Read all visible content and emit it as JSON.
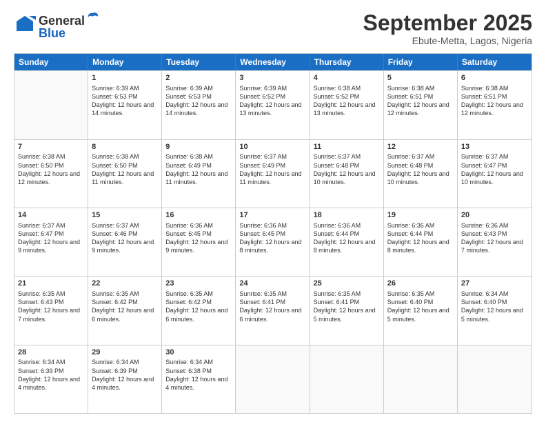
{
  "header": {
    "logo_general": "General",
    "logo_blue": "Blue",
    "month_title": "September 2025",
    "location": "Ebute-Metta, Lagos, Nigeria"
  },
  "calendar": {
    "days_of_week": [
      "Sunday",
      "Monday",
      "Tuesday",
      "Wednesday",
      "Thursday",
      "Friday",
      "Saturday"
    ],
    "weeks": [
      [
        {
          "day": "",
          "sunrise": "",
          "sunset": "",
          "daylight": "",
          "empty": true
        },
        {
          "day": "1",
          "sunrise": "Sunrise: 6:39 AM",
          "sunset": "Sunset: 6:53 PM",
          "daylight": "Daylight: 12 hours and 14 minutes.",
          "empty": false
        },
        {
          "day": "2",
          "sunrise": "Sunrise: 6:39 AM",
          "sunset": "Sunset: 6:53 PM",
          "daylight": "Daylight: 12 hours and 14 minutes.",
          "empty": false
        },
        {
          "day": "3",
          "sunrise": "Sunrise: 6:39 AM",
          "sunset": "Sunset: 6:52 PM",
          "daylight": "Daylight: 12 hours and 13 minutes.",
          "empty": false
        },
        {
          "day": "4",
          "sunrise": "Sunrise: 6:38 AM",
          "sunset": "Sunset: 6:52 PM",
          "daylight": "Daylight: 12 hours and 13 minutes.",
          "empty": false
        },
        {
          "day": "5",
          "sunrise": "Sunrise: 6:38 AM",
          "sunset": "Sunset: 6:51 PM",
          "daylight": "Daylight: 12 hours and 12 minutes.",
          "empty": false
        },
        {
          "day": "6",
          "sunrise": "Sunrise: 6:38 AM",
          "sunset": "Sunset: 6:51 PM",
          "daylight": "Daylight: 12 hours and 12 minutes.",
          "empty": false
        }
      ],
      [
        {
          "day": "7",
          "sunrise": "Sunrise: 6:38 AM",
          "sunset": "Sunset: 6:50 PM",
          "daylight": "Daylight: 12 hours and 12 minutes.",
          "empty": false
        },
        {
          "day": "8",
          "sunrise": "Sunrise: 6:38 AM",
          "sunset": "Sunset: 6:50 PM",
          "daylight": "Daylight: 12 hours and 11 minutes.",
          "empty": false
        },
        {
          "day": "9",
          "sunrise": "Sunrise: 6:38 AM",
          "sunset": "Sunset: 6:49 PM",
          "daylight": "Daylight: 12 hours and 11 minutes.",
          "empty": false
        },
        {
          "day": "10",
          "sunrise": "Sunrise: 6:37 AM",
          "sunset": "Sunset: 6:49 PM",
          "daylight": "Daylight: 12 hours and 11 minutes.",
          "empty": false
        },
        {
          "day": "11",
          "sunrise": "Sunrise: 6:37 AM",
          "sunset": "Sunset: 6:48 PM",
          "daylight": "Daylight: 12 hours and 10 minutes.",
          "empty": false
        },
        {
          "day": "12",
          "sunrise": "Sunrise: 6:37 AM",
          "sunset": "Sunset: 6:48 PM",
          "daylight": "Daylight: 12 hours and 10 minutes.",
          "empty": false
        },
        {
          "day": "13",
          "sunrise": "Sunrise: 6:37 AM",
          "sunset": "Sunset: 6:47 PM",
          "daylight": "Daylight: 12 hours and 10 minutes.",
          "empty": false
        }
      ],
      [
        {
          "day": "14",
          "sunrise": "Sunrise: 6:37 AM",
          "sunset": "Sunset: 6:47 PM",
          "daylight": "Daylight: 12 hours and 9 minutes.",
          "empty": false
        },
        {
          "day": "15",
          "sunrise": "Sunrise: 6:37 AM",
          "sunset": "Sunset: 6:46 PM",
          "daylight": "Daylight: 12 hours and 9 minutes.",
          "empty": false
        },
        {
          "day": "16",
          "sunrise": "Sunrise: 6:36 AM",
          "sunset": "Sunset: 6:45 PM",
          "daylight": "Daylight: 12 hours and 9 minutes.",
          "empty": false
        },
        {
          "day": "17",
          "sunrise": "Sunrise: 6:36 AM",
          "sunset": "Sunset: 6:45 PM",
          "daylight": "Daylight: 12 hours and 8 minutes.",
          "empty": false
        },
        {
          "day": "18",
          "sunrise": "Sunrise: 6:36 AM",
          "sunset": "Sunset: 6:44 PM",
          "daylight": "Daylight: 12 hours and 8 minutes.",
          "empty": false
        },
        {
          "day": "19",
          "sunrise": "Sunrise: 6:36 AM",
          "sunset": "Sunset: 6:44 PM",
          "daylight": "Daylight: 12 hours and 8 minutes.",
          "empty": false
        },
        {
          "day": "20",
          "sunrise": "Sunrise: 6:36 AM",
          "sunset": "Sunset: 6:43 PM",
          "daylight": "Daylight: 12 hours and 7 minutes.",
          "empty": false
        }
      ],
      [
        {
          "day": "21",
          "sunrise": "Sunrise: 6:35 AM",
          "sunset": "Sunset: 6:43 PM",
          "daylight": "Daylight: 12 hours and 7 minutes.",
          "empty": false
        },
        {
          "day": "22",
          "sunrise": "Sunrise: 6:35 AM",
          "sunset": "Sunset: 6:42 PM",
          "daylight": "Daylight: 12 hours and 6 minutes.",
          "empty": false
        },
        {
          "day": "23",
          "sunrise": "Sunrise: 6:35 AM",
          "sunset": "Sunset: 6:42 PM",
          "daylight": "Daylight: 12 hours and 6 minutes.",
          "empty": false
        },
        {
          "day": "24",
          "sunrise": "Sunrise: 6:35 AM",
          "sunset": "Sunset: 6:41 PM",
          "daylight": "Daylight: 12 hours and 6 minutes.",
          "empty": false
        },
        {
          "day": "25",
          "sunrise": "Sunrise: 6:35 AM",
          "sunset": "Sunset: 6:41 PM",
          "daylight": "Daylight: 12 hours and 5 minutes.",
          "empty": false
        },
        {
          "day": "26",
          "sunrise": "Sunrise: 6:35 AM",
          "sunset": "Sunset: 6:40 PM",
          "daylight": "Daylight: 12 hours and 5 minutes.",
          "empty": false
        },
        {
          "day": "27",
          "sunrise": "Sunrise: 6:34 AM",
          "sunset": "Sunset: 6:40 PM",
          "daylight": "Daylight: 12 hours and 5 minutes.",
          "empty": false
        }
      ],
      [
        {
          "day": "28",
          "sunrise": "Sunrise: 6:34 AM",
          "sunset": "Sunset: 6:39 PM",
          "daylight": "Daylight: 12 hours and 4 minutes.",
          "empty": false
        },
        {
          "day": "29",
          "sunrise": "Sunrise: 6:34 AM",
          "sunset": "Sunset: 6:39 PM",
          "daylight": "Daylight: 12 hours and 4 minutes.",
          "empty": false
        },
        {
          "day": "30",
          "sunrise": "Sunrise: 6:34 AM",
          "sunset": "Sunset: 6:38 PM",
          "daylight": "Daylight: 12 hours and 4 minutes.",
          "empty": false
        },
        {
          "day": "",
          "sunrise": "",
          "sunset": "",
          "daylight": "",
          "empty": true
        },
        {
          "day": "",
          "sunrise": "",
          "sunset": "",
          "daylight": "",
          "empty": true
        },
        {
          "day": "",
          "sunrise": "",
          "sunset": "",
          "daylight": "",
          "empty": true
        },
        {
          "day": "",
          "sunrise": "",
          "sunset": "",
          "daylight": "",
          "empty": true
        }
      ]
    ]
  }
}
